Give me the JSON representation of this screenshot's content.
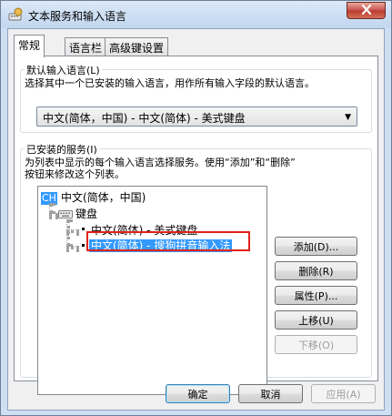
{
  "window": {
    "title": "文本服务和输入语言",
    "icon": "keyboard-globe-icon",
    "close_icon": "close-icon"
  },
  "tabs": [
    {
      "label": "常规",
      "active": true
    },
    {
      "label": "语言栏",
      "active": false
    },
    {
      "label": "高级键设置",
      "active": false
    }
  ],
  "default_language": {
    "legend": "默认输入语言(L)",
    "description": "选择其中一个已安装的输入语言，用作所有输入字段的默认语言。",
    "selected": "中文(简体，中国) - 中文(简体) - 美式键盘"
  },
  "installed_services": {
    "legend": "已安装的服务(I)",
    "description_line1": "为列表中显示的每个输入语言选择服务。使用“添加”和“删除”",
    "description_line2": "按钮来修改这个列表。",
    "tree": {
      "language_badge": "CH",
      "language": "中文(简体，中国)",
      "category": "键盘",
      "items": [
        "中文(简体) - 美式键盘",
        "中文(简体) - 搜狗拼音输入法"
      ],
      "selected_index": 1
    },
    "buttons": {
      "add": "添加(D)...",
      "remove": "删除(R)",
      "properties": "属性(P)...",
      "move_up": "上移(U)",
      "move_down": "下移(O)"
    }
  },
  "footer": {
    "ok": "确定",
    "cancel": "取消",
    "apply": "应用(A)"
  },
  "colors": {
    "selection": "#3399ff",
    "highlight_box": "#e2231a",
    "close_button": "#c75050"
  }
}
